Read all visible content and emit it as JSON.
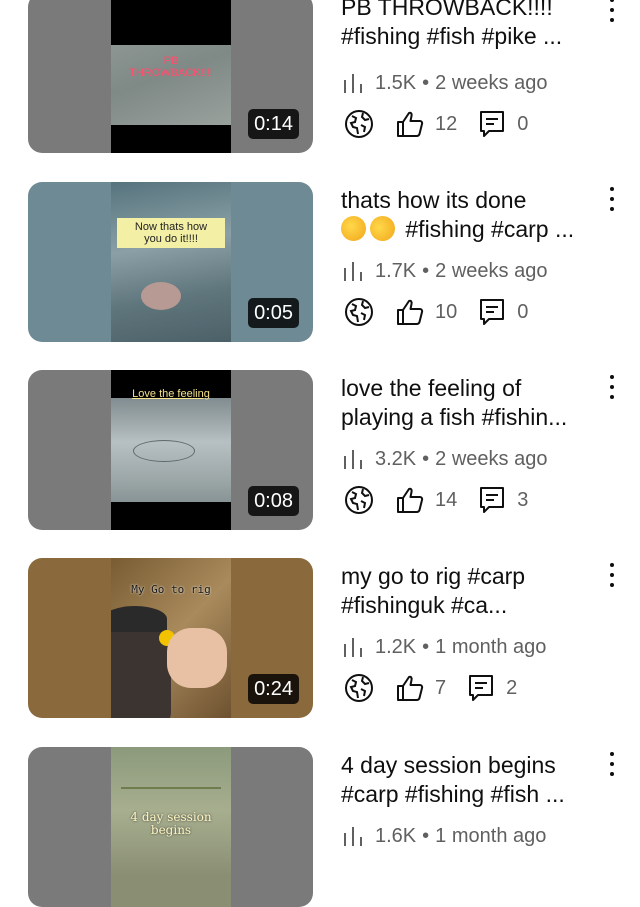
{
  "videos": [
    {
      "overlay": "PB\nTHROWBACK!!!!",
      "duration": "0:14",
      "title": "PB THROWBACK!!!! #fishing #fish #pike ...",
      "views": "1.5K",
      "age": "2 weeks ago",
      "likes": "12",
      "comments": "0"
    },
    {
      "overlay": "Now thats how\nyou do it!!!!",
      "duration": "0:05",
      "title_text": "#fishing #carp ...",
      "title_first_line": "thats how its done",
      "emojis": [
        "smiling-face-with-sweat",
        "rolling-on-the-floor-laughing"
      ],
      "views": "1.7K",
      "age": "2 weeks ago",
      "likes": "10",
      "comments": "0"
    },
    {
      "overlay": "Love the feeling",
      "duration": "0:08",
      "title": "love the feeling of playing a fish #fishin...",
      "views": "3.2K",
      "age": "2 weeks ago",
      "likes": "14",
      "comments": "3"
    },
    {
      "overlay": "My Go to rig",
      "duration": "0:24",
      "title": "my go to rig #carp #fishinguk #ca...",
      "views": "1.2K",
      "age": "1 month ago",
      "likes": "7",
      "comments": "2"
    },
    {
      "overlay": "4 day session\nbegins",
      "title": "4 day session begins #carp #fishing #fish ...",
      "views": "1.6K",
      "age": "1 month ago"
    }
  ],
  "meta_separator": "•",
  "icons": [
    "bar-chart-icon",
    "public-globe-icon",
    "like-icon",
    "comment-icon",
    "more-vert-icon"
  ]
}
